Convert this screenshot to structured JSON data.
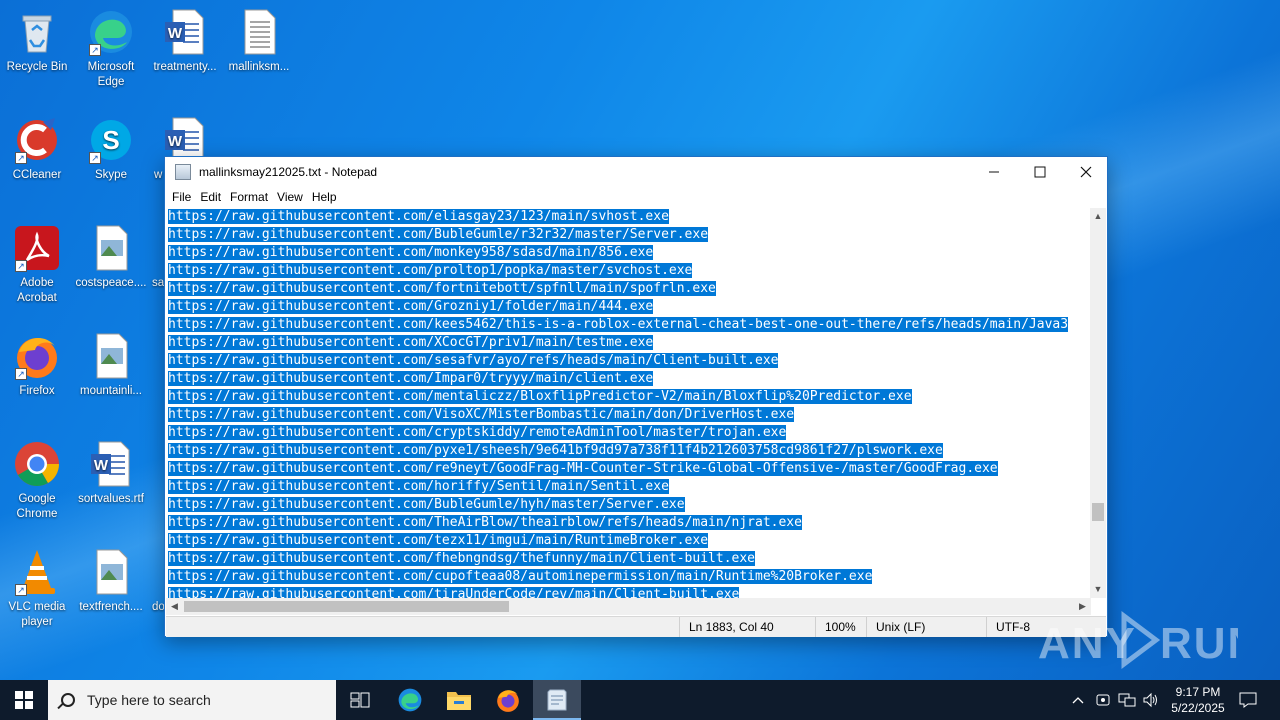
{
  "desktop": {
    "icons": [
      {
        "label": "Recycle Bin"
      },
      {
        "label": "Microsoft Edge"
      },
      {
        "label": "treatmenty..."
      },
      {
        "label": "mallinksm..."
      },
      {
        "label": "CCleaner"
      },
      {
        "label": "Skype"
      },
      {
        "label": "w"
      },
      {
        "label": "Adobe Acrobat"
      },
      {
        "label": "costspeace...."
      },
      {
        "label": "sa"
      },
      {
        "label": "Firefox"
      },
      {
        "label": "mountainli..."
      },
      {
        "label": "Google Chrome"
      },
      {
        "label": "sortvalues.rtf"
      },
      {
        "label": "VLC media player"
      },
      {
        "label": "textfrench...."
      },
      {
        "label": "do"
      }
    ]
  },
  "notepad": {
    "title": "mallinksmay212025.txt - Notepad",
    "menu": [
      "File",
      "Edit",
      "Format",
      "View",
      "Help"
    ],
    "lines": [
      "https://raw.githubusercontent.com/eliasgay23/123/main/svhost.exe",
      "https://raw.githubusercontent.com/BubleGumle/r32r32/master/Server.exe",
      "https://raw.githubusercontent.com/monkey958/sdasd/main/856.exe",
      "https://raw.githubusercontent.com/proltop1/popka/master/svchost.exe",
      "https://raw.githubusercontent.com/fortnitebott/spfnll/main/spofrln.exe",
      "https://raw.githubusercontent.com/Grozniy1/folder/main/444.exe",
      "https://raw.githubusercontent.com/kees5462/this-is-a-roblox-external-cheat-best-one-out-there/refs/heads/main/Java3",
      "https://raw.githubusercontent.com/XCocGT/priv1/main/testme.exe",
      "https://raw.githubusercontent.com/sesafvr/ayo/refs/heads/main/Client-built.exe",
      "https://raw.githubusercontent.com/Impar0/tryyy/main/client.exe",
      "https://raw.githubusercontent.com/mentaliczz/BloxflipPredictor-V2/main/Bloxflip%20Predictor.exe",
      "https://raw.githubusercontent.com/VisoXC/MisterBombastic/main/don/DriverHost.exe",
      "https://raw.githubusercontent.com/cryptskiddy/remoteAdminTool/master/trojan.exe",
      "https://raw.githubusercontent.com/pyxe1/sheesh/9e641bf9dd97a738f11f4b212603758cd9861f27/plswork.exe",
      "https://raw.githubusercontent.com/re9neyt/GoodFrag-MH-Counter-Strike-Global-Offensive-/master/GoodFrag.exe",
      "https://raw.githubusercontent.com/horiffy/Sentil/main/Sentil.exe",
      "https://raw.githubusercontent.com/BubleGumle/hyh/master/Server.exe",
      "https://raw.githubusercontent.com/TheAirBlow/theairblow/refs/heads/main/njrat.exe",
      "https://raw.githubusercontent.com/tezx11/imgui/main/RuntimeBroker.exe",
      "https://raw.githubusercontent.com/fhebngndsg/thefunny/main/Client-built.exe",
      "https://raw.githubusercontent.com/cupofteaa08/autominepermission/main/Runtime%20Broker.exe",
      "https://raw.githubusercontent.com/tiraUnderCode/rev/main/Client-built.exe"
    ],
    "status": {
      "position": "Ln 1883, Col 40",
      "zoom": "100%",
      "line_ending": "Unix (LF)",
      "encoding": "UTF-8"
    }
  },
  "taskbar": {
    "search_placeholder": "Type here to search",
    "time": "9:17 PM",
    "date": "5/22/2025"
  },
  "watermark": "ANY RUN"
}
